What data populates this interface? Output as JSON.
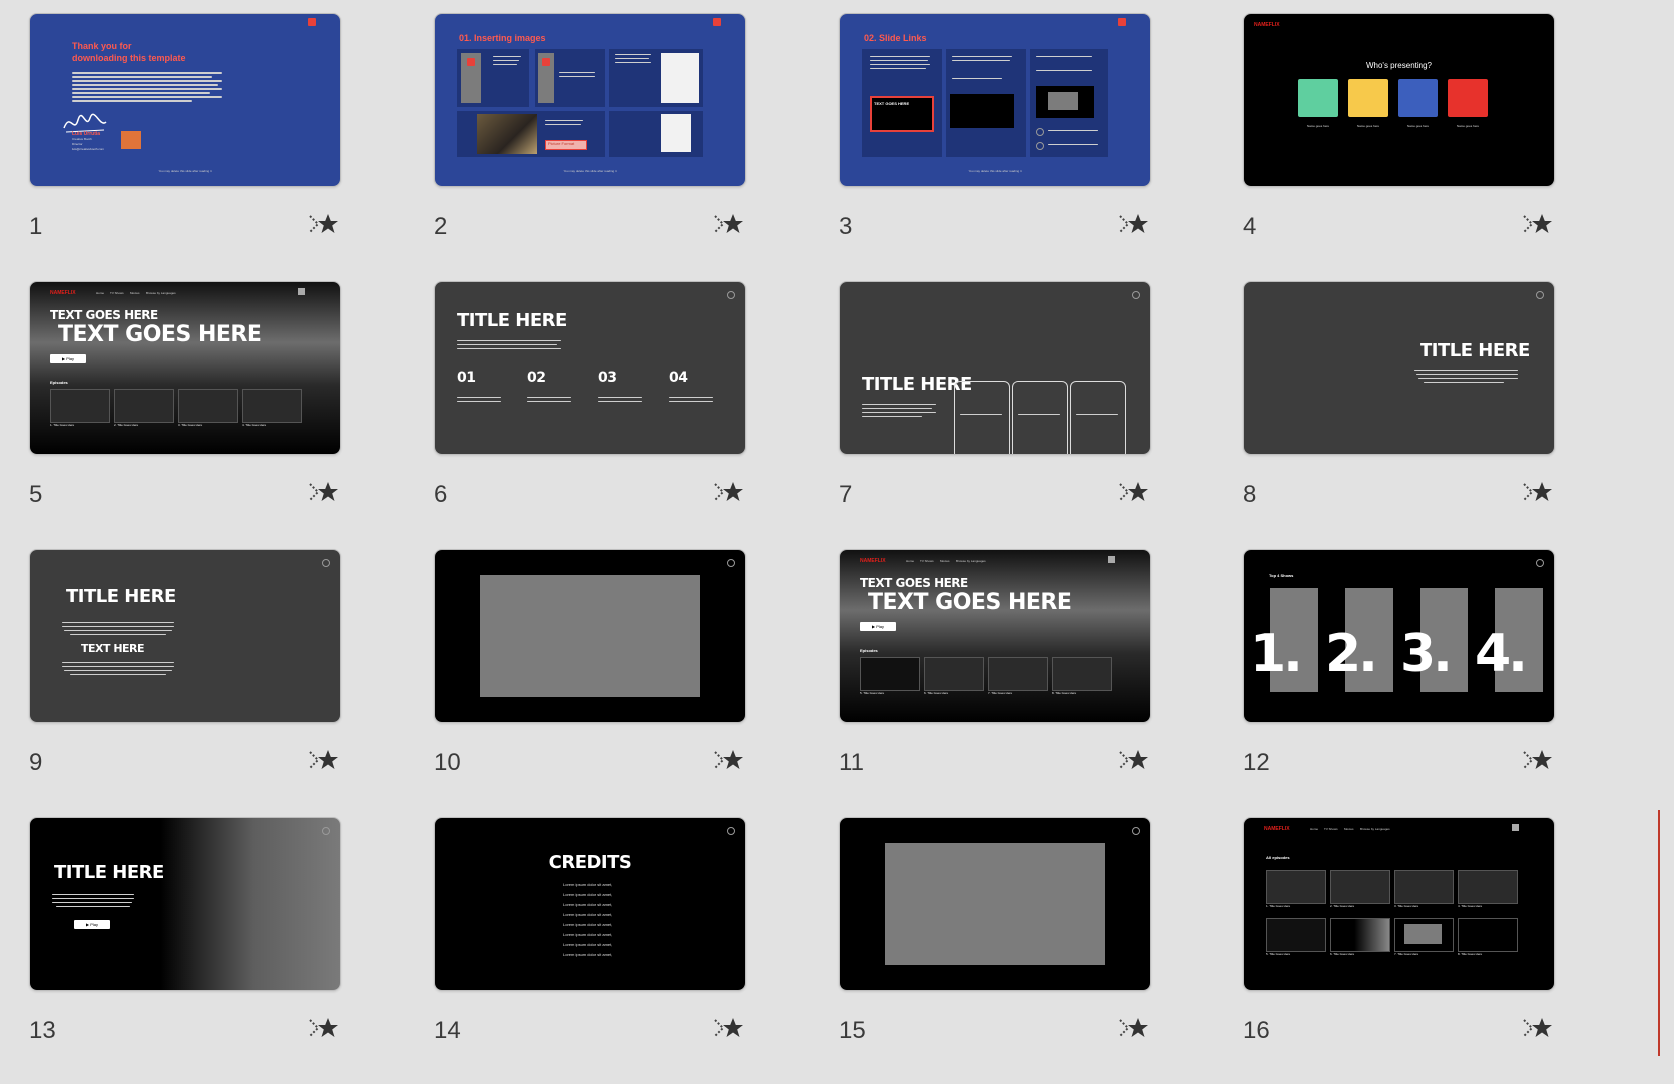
{
  "slides": [
    {
      "number": "1",
      "thanks_line1": "Thank you for",
      "thanks_line2": "downloading this template",
      "author": "Luis Urrutia",
      "role_1": "Creative Booth",
      "role_2": "Director",
      "email": "luis@creativebooth.com",
      "footer": "You may delete this slide after reading it"
    },
    {
      "number": "2",
      "heading": "01. Inserting images",
      "button": "Picture Format",
      "footer": "You may delete this slide after reading it"
    },
    {
      "number": "3",
      "heading": "02. Slide Links",
      "cover_text": "TEXT GOES HERE",
      "footer": "You may delete this slide after reading it"
    },
    {
      "number": "4",
      "brand": "NAMEFLIX",
      "question": "Who's presenting?",
      "profiles": [
        "Name goes here",
        "Name goes here",
        "Name goes here",
        "Name goes here"
      ]
    },
    {
      "number": "5",
      "brand": "NAMEFLIX",
      "nav": [
        "Home",
        "TV Shows",
        "Movies",
        "Browse by Languages"
      ],
      "small_title": "TEXT GOES HERE",
      "big_title": "TEXT GOES HERE",
      "play": "▶ Play",
      "episodes_label": "Episodes",
      "episodes": [
        "1. Title Goes Here",
        "2. Title Goes Here",
        "3. Title Goes Here",
        "4. Title Goes Here"
      ]
    },
    {
      "number": "6",
      "title": "TITLE HERE",
      "cols": [
        "01",
        "02",
        "03",
        "04"
      ]
    },
    {
      "number": "7",
      "title": "TITLE HERE"
    },
    {
      "number": "8",
      "title": "TITLE HERE"
    },
    {
      "number": "9",
      "title": "TITLE HERE",
      "subtitle": "TEXT HERE"
    },
    {
      "number": "10"
    },
    {
      "number": "11",
      "brand": "NAMEFLIX",
      "nav": [
        "Home",
        "TV Shows",
        "Movies",
        "Browse by Languages"
      ],
      "small_title": "TEXT GOES HERE",
      "big_title": "TEXT GOES HERE",
      "play": "▶ Play",
      "episodes_label": "Episodes",
      "episodes": [
        "5. Title Goes Here",
        "6. Title Goes Here",
        "7. Title Goes Here",
        "8. Title Goes Here"
      ]
    },
    {
      "number": "12",
      "label": "Top 4 Shows",
      "ranks": [
        "1.",
        "2.",
        "3.",
        "4."
      ]
    },
    {
      "number": "13",
      "title": "TITLE HERE",
      "play": "▶ Play"
    },
    {
      "number": "14",
      "title": "CREDITS",
      "credit_line": "Lorem ipsum dolor sit amet,"
    },
    {
      "number": "15"
    },
    {
      "number": "16",
      "brand": "NAMEFLIX",
      "nav": [
        "Home",
        "TV Shows",
        "Movies",
        "Browse by Languages"
      ],
      "label": "All episodes",
      "episodes": [
        "1. Title Goes Here",
        "2. Title Goes Here",
        "3. Title Goes Here",
        "4. Title Goes Here",
        "5. Title Goes Here",
        "6. Title Goes Here",
        "7. Title Goes Here",
        "8. Title Goes Here"
      ]
    }
  ],
  "icons": {
    "transition": "transition-star-icon",
    "back": "back-arrow-icon"
  },
  "colors": {
    "background": "#e2e2e2",
    "blue_slide": "#2c4698",
    "accent_red": "#ff5a4e",
    "dark_slide": "#3d3d3d"
  }
}
